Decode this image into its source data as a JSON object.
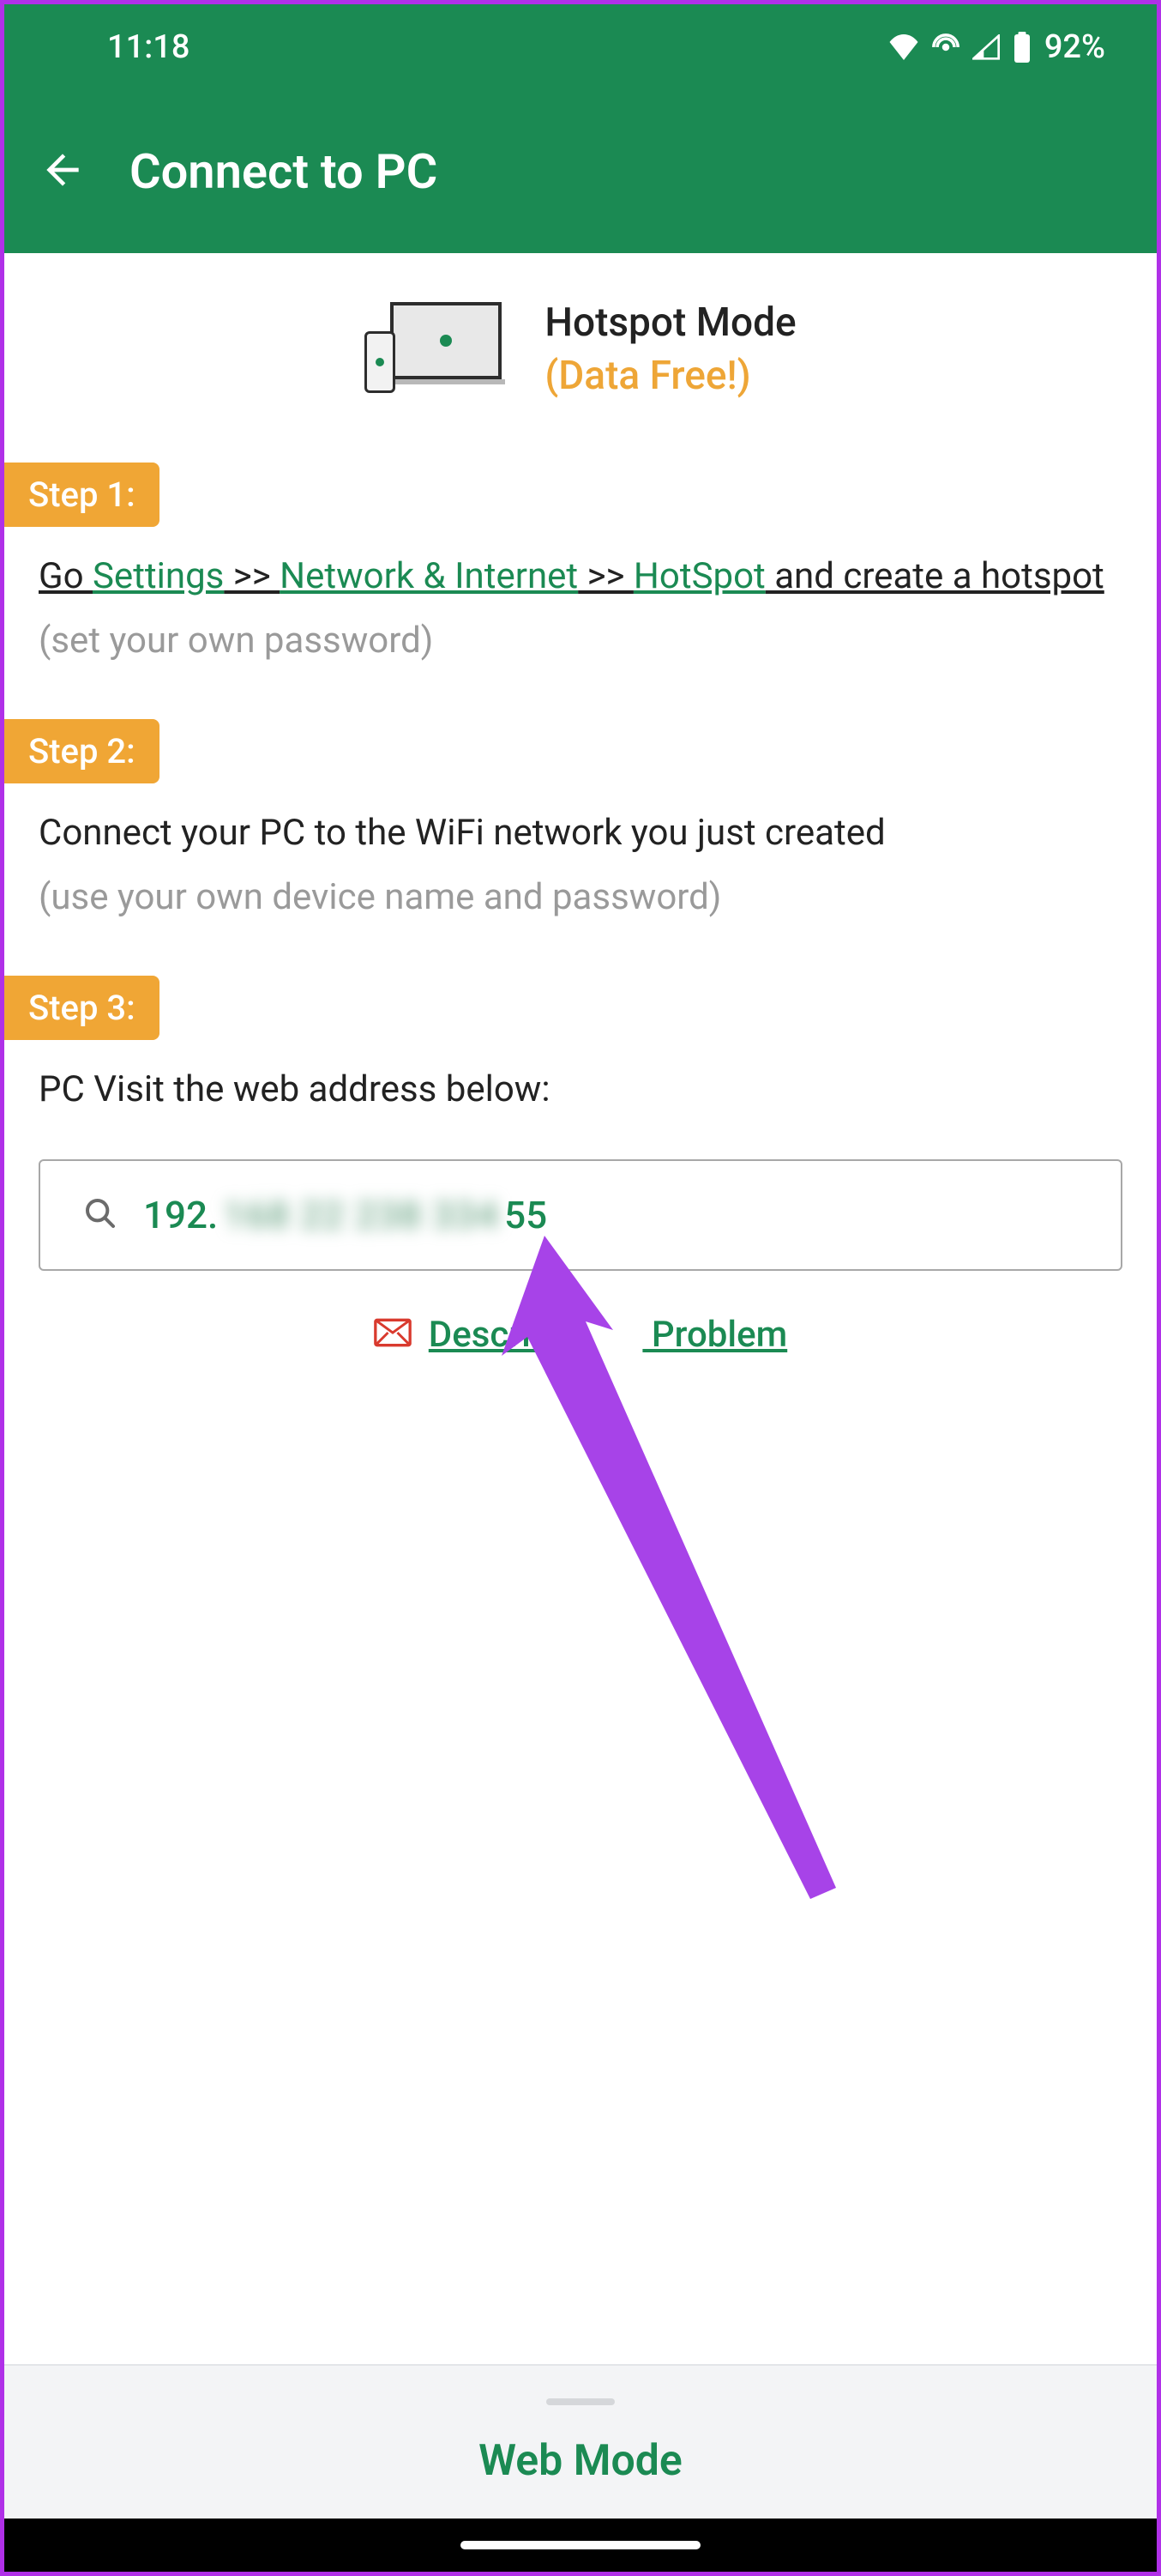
{
  "status": {
    "time": "11:18",
    "battery": "92%"
  },
  "appbar": {
    "title": "Connect to PC"
  },
  "hero": {
    "title": "Hotspot Mode",
    "subtitle": "(Data Free!)"
  },
  "steps": {
    "s1": {
      "badge": "Step 1:",
      "go": "Go ",
      "settings": "Settings",
      "sep1": " >> ",
      "network": "Network & Internet",
      "sep2": " >> ",
      "hotspot": "HotSpot",
      "tail": " and create a hotspot",
      "hint": "(set your own password)"
    },
    "s2": {
      "badge": "Step 2:",
      "text": "Connect your PC to the WiFi network you just created",
      "hint": "(use your own device name and password)"
    },
    "s3": {
      "badge": "Step 3:",
      "text": "PC Visit the web address below:"
    }
  },
  "address": {
    "prefix": "192.",
    "blurred": "168 22 238 334",
    "suffix": "55"
  },
  "describe": {
    "label_pre": "Describe",
    "label_post": " Problem"
  },
  "sheet": {
    "label": "Web Mode"
  }
}
